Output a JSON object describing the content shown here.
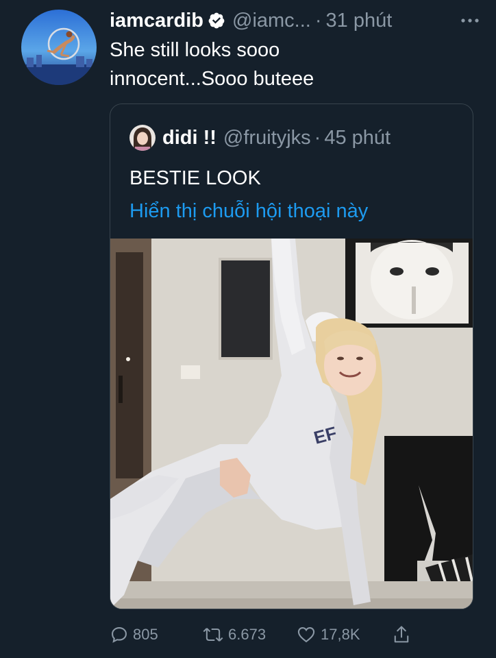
{
  "tweet": {
    "display_name": "iamcardib",
    "verified_icon": "verified-badge-icon",
    "handle": "@iamc...",
    "separator": "·",
    "time": "31 phút",
    "more_icon": "more-icon",
    "text": "She still looks sooo\ninnocent...Sooo buteee"
  },
  "quote": {
    "display_name": "didi !!",
    "handle": "@fruityjks",
    "separator": "·",
    "time": "45 phút",
    "text": "BESTIE LOOK",
    "thread_link": "Hiển thị chuỗi hội thoại này"
  },
  "actions": {
    "reply_count": "805",
    "retweet_count": "6.673",
    "like_count": "17,8K",
    "reply_icon": "reply-icon",
    "retweet_icon": "retweet-icon",
    "like_icon": "heart-icon",
    "share_icon": "share-icon"
  },
  "colors": {
    "background": "#15202b",
    "secondary_text": "#8b98a5",
    "link": "#1d9bf0",
    "border": "#38444d"
  }
}
